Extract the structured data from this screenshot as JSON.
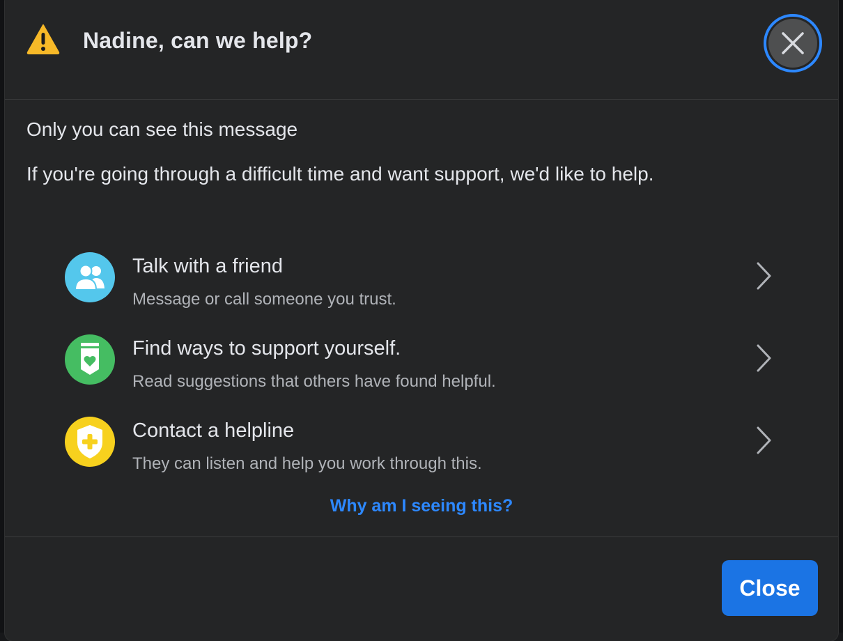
{
  "dialog": {
    "title": "Nadine, can we help?",
    "title_icon": "warning-triangle-icon",
    "close_icon": "close-x-icon",
    "message_private": "Only you can see this message",
    "message_support": "If you're going through a difficult time and want support, we'd like to help."
  },
  "options": [
    {
      "title": "Talk with a friend",
      "subtitle": "Message or call someone you trust.",
      "icon": "people-icon",
      "icon_color": "#54c7ec"
    },
    {
      "title": "Find ways to support yourself.",
      "subtitle": "Read suggestions that others have found helpful.",
      "icon": "heart-badge-icon",
      "icon_color": "#45bd62"
    },
    {
      "title": "Contact a helpline",
      "subtitle": "They can listen and help you work through this.",
      "icon": "shield-plus-icon",
      "icon_color": "#f7d11e"
    }
  ],
  "why_link": "Why am I seeing this?",
  "footer": {
    "close_label": "Close"
  },
  "colors": {
    "dialog_bg": "#242526",
    "accent": "#2d88ff",
    "button_bg": "#1b74e4",
    "text_primary": "#e4e6eb",
    "text_secondary": "#b0b3b8"
  }
}
